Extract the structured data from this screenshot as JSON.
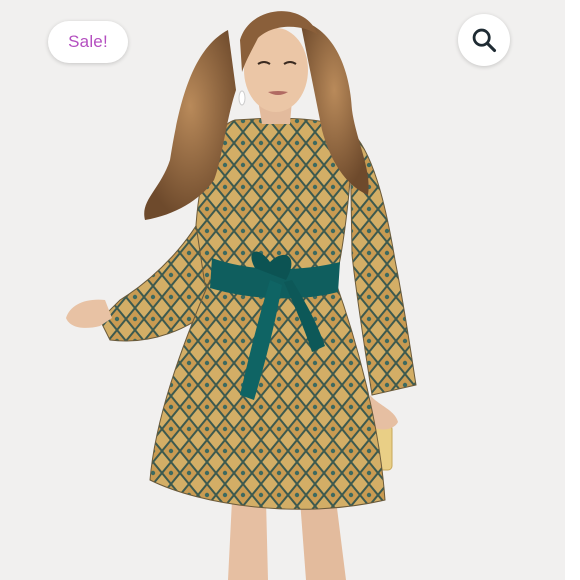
{
  "badge": {
    "label": "Sale!"
  },
  "controls": {
    "search_icon": "search-icon"
  },
  "colors": {
    "badge_text": "#b44fc0",
    "belt": "#0f5e5e",
    "dress_base": "#c9a560",
    "dress_lines": "#3d5a4f",
    "background": "#f1f0ef"
  }
}
